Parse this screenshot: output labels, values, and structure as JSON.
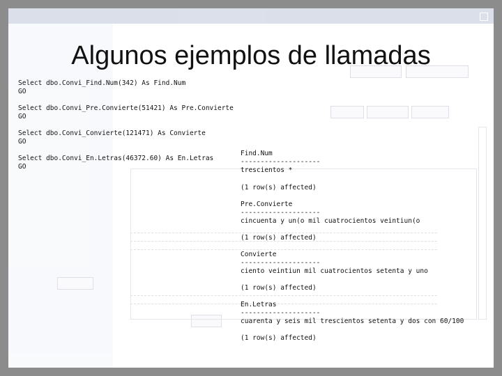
{
  "slide_title": "Algunos ejemplos de llamadas",
  "queries": [
    {
      "statement": "Select dbo.Convi_Find.Num(342) As Find.Num",
      "go": "GO"
    },
    {
      "statement": "Select dbo.Convi_Pre.Convierte(51421) As Pre.Convierte",
      "go": "GO"
    },
    {
      "statement": "Select dbo.Convi_Convierte(121471) As Convierte",
      "go": "GO"
    },
    {
      "statement": "Select dbo.Convi_En.Letras(46372.60) As En.Letras",
      "go": "GO"
    }
  ],
  "results": [
    {
      "column": "Find.Num",
      "separator": "--------------------",
      "value": "trescientos *",
      "rows": "(1 row(s) affected)"
    },
    {
      "column": "Pre.Convierte",
      "separator": "--------------------",
      "value": "cincuenta y un(o mil cuatrocientos veintiun(o",
      "rows": "(1 row(s) affected)"
    },
    {
      "column": "Convierte",
      "separator": "--------------------",
      "value": "ciento veintiun mil cuatrocientos setenta y uno",
      "rows": "(1 row(s) affected)"
    },
    {
      "column": "En.Letras",
      "separator": "--------------------",
      "value": "cuarenta y seis mil trescientos setenta y dos con 60/100",
      "rows": "(1 row(s) affected)"
    }
  ]
}
